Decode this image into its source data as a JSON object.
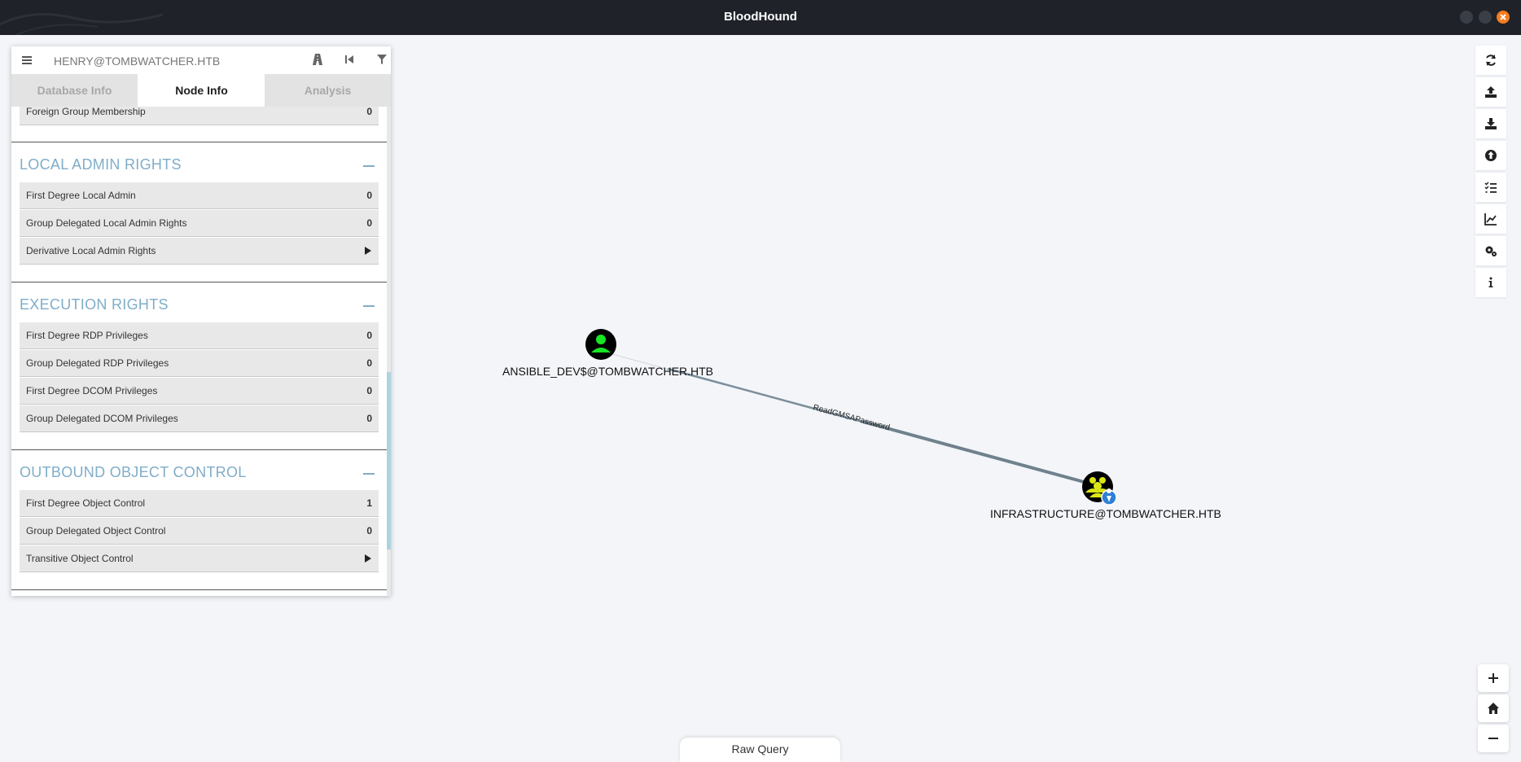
{
  "app": {
    "title": "BloodHound"
  },
  "search": {
    "value": "HENRY@TOMBWATCHER.HTB"
  },
  "tabs": {
    "database_info": "Database Info",
    "node_info": "Node Info",
    "analysis": "Analysis"
  },
  "partial_row": {
    "label": "Foreign Group Membership",
    "value": "0"
  },
  "sections": {
    "local_admin": {
      "title": "LOCAL ADMIN RIGHTS",
      "rows": [
        {
          "label": "First Degree Local Admin",
          "value": "0"
        },
        {
          "label": "Group Delegated Local Admin Rights",
          "value": "0"
        },
        {
          "label": "Derivative Local Admin Rights",
          "value": ""
        }
      ]
    },
    "execution": {
      "title": "EXECUTION RIGHTS",
      "rows": [
        {
          "label": "First Degree RDP Privileges",
          "value": "0"
        },
        {
          "label": "Group Delegated RDP Privileges",
          "value": "0"
        },
        {
          "label": "First Degree DCOM Privileges",
          "value": "0"
        },
        {
          "label": "Group Delegated DCOM Privileges",
          "value": "0"
        }
      ]
    },
    "outbound": {
      "title": "OUTBOUND OBJECT CONTROL",
      "rows": [
        {
          "label": "First Degree Object Control",
          "value": "1"
        },
        {
          "label": "Group Delegated Object Control",
          "value": "0"
        },
        {
          "label": "Transitive Object Control",
          "value": ""
        }
      ]
    }
  },
  "graph": {
    "source_node": {
      "label": "ANSIBLE_DEV$@TOMBWATCHER.HTB",
      "type": "user-icon"
    },
    "target_node": {
      "label": "INFRASTRUCTURE@TOMBWATCHER.HTB",
      "type": "group-icon"
    },
    "edge_label": "ReadGMSAPassword"
  },
  "raw_query": {
    "label": "Raw Query"
  },
  "right_toolbar": [
    "refresh-icon",
    "upload-icon",
    "download-icon",
    "import-icon",
    "query-list-icon",
    "chart-icon",
    "settings-icon",
    "info-icon"
  ],
  "zoom_controls": [
    "zoom-in-icon",
    "home-icon",
    "zoom-out-icon"
  ],
  "colors": {
    "titlebar": "#1f2229",
    "close_button": "#f57c1f",
    "section_title": "#7fadc9",
    "user_node": "#17e625",
    "group_node": "#dbe617",
    "edge": "#7b8d99"
  }
}
